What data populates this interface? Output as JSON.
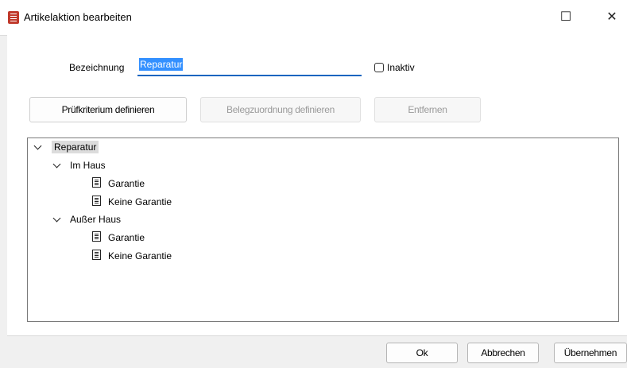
{
  "window": {
    "title": "Artikelaktion bearbeiten",
    "maximize_glyph": "☐",
    "close_glyph": "✕"
  },
  "form": {
    "bezeichnung_label": "Bezeichnung",
    "bezeichnung_value": "Reparatur",
    "inaktiv_label": "Inaktiv",
    "inaktiv_checked": false
  },
  "toolbar": {
    "pruefkriterium_label": "Prüfkriterium definieren",
    "belegzuordnung_label": "Belegzuordnung definieren",
    "entfernen_label": "Entfernen"
  },
  "tree": {
    "root": "Reparatur",
    "groups": [
      {
        "label": "Im Haus",
        "items": [
          "Garantie",
          "Keine Garantie"
        ]
      },
      {
        "label": "Außer Haus",
        "items": [
          "Garantie",
          "Keine Garantie"
        ]
      }
    ]
  },
  "footer": {
    "ok_label": "Ok",
    "abbrechen_label": "Abbrechen",
    "uebernehmen_label": "Übernehmen"
  },
  "colors": {
    "accent": "#1565c0",
    "selection": "#3390ff",
    "app_icon": "#c0392b"
  }
}
